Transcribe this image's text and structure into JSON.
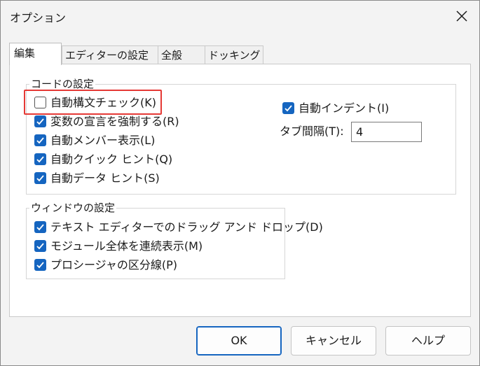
{
  "window": {
    "title": "オプション"
  },
  "tabs": [
    {
      "label": "編集",
      "active": true
    },
    {
      "label": "エディターの設定",
      "active": false
    },
    {
      "label": "全般",
      "active": false
    },
    {
      "label": "ドッキング",
      "active": false
    }
  ],
  "code_settings": {
    "label": "コードの設定",
    "options": [
      {
        "label": "自動構文チェック(K)",
        "checked": false
      },
      {
        "label": "変数の宣言を強制する(R)",
        "checked": true
      },
      {
        "label": "自動メンバー表示(L)",
        "checked": true
      },
      {
        "label": "自動クイック ヒント(Q)",
        "checked": true
      },
      {
        "label": "自動データ ヒント(S)",
        "checked": true
      }
    ],
    "auto_indent": {
      "label": "自動インデント(I)",
      "checked": true
    },
    "tab_width": {
      "label": "タブ間隔(T):",
      "value": "4"
    }
  },
  "window_settings": {
    "label": "ウィンドウの設定",
    "options": [
      {
        "label": "テキスト エディターでのドラッグ アンド ドロップ(D)",
        "checked": true
      },
      {
        "label": "モジュール全体を連続表示(M)",
        "checked": true
      },
      {
        "label": "プロシージャの区分線(P)",
        "checked": true
      }
    ]
  },
  "buttons": {
    "ok": "OK",
    "cancel": "キャンセル",
    "help": "ヘルプ"
  },
  "colors": {
    "accent": "#1565c0",
    "highlight": "#e53935"
  }
}
